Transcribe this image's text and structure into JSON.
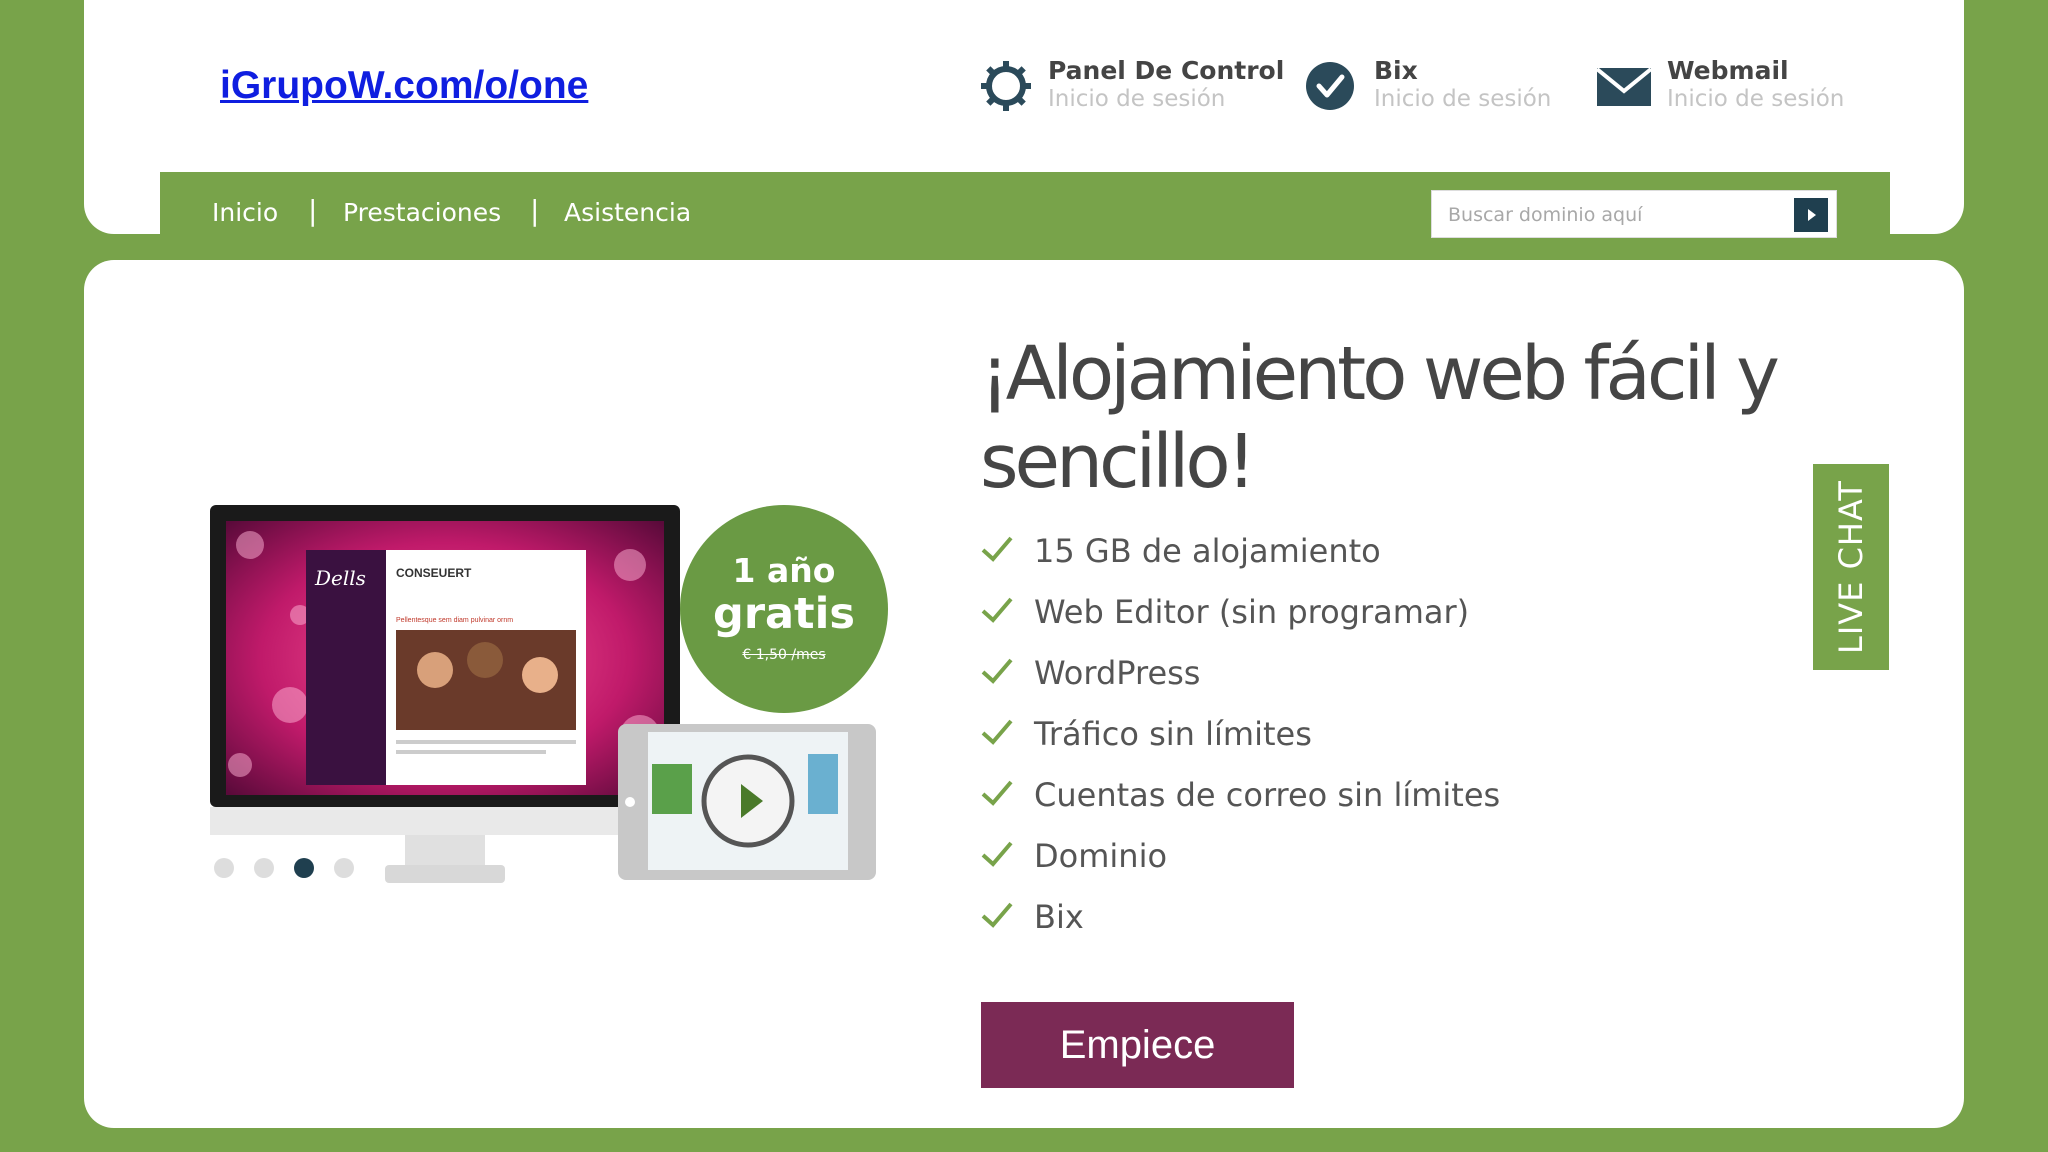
{
  "site_link": "iGrupoW.com/o/one",
  "header": {
    "panel": {
      "title": "Panel De Control",
      "subtitle": "Inicio de sesión",
      "icon": "gear-icon"
    },
    "bix": {
      "title": "Bix",
      "subtitle": "Inicio de sesión",
      "icon": "check-circle-icon"
    },
    "webmail": {
      "title": "Webmail",
      "subtitle": "Inicio de sesión",
      "icon": "envelope-icon"
    }
  },
  "nav": {
    "items": [
      "Inicio",
      "Prestaciones",
      "Asistencia"
    ],
    "separator": "|",
    "search_placeholder": "Buscar dominio aquí"
  },
  "hero": {
    "headline_line1": "¡Alojamiento web fácil y",
    "headline_line2": "sencillo!",
    "features": [
      "15 GB de alojamiento",
      "Web Editor (sin programar)",
      "WordPress",
      "Tráfico sin límites",
      "Cuentas de correo sin límites",
      "Dominio",
      "Bix"
    ],
    "cta_label": "Empiece"
  },
  "badge": {
    "line1": "1 año",
    "line2": "gratis",
    "line3": "€ 1,50 /mes"
  },
  "monitor_site": {
    "logo": "Dells",
    "heading": "CONSEUERT",
    "tagline": "Pellentesque sem diam pulvinar ornm"
  },
  "carousel": {
    "count": 4,
    "active_index": 2
  },
  "live_chat_label": "LIVE CHAT",
  "colors": {
    "brand_green": "#78a34a",
    "cta_purple": "#7b2a55",
    "dark_teal": "#1f3f4f"
  }
}
